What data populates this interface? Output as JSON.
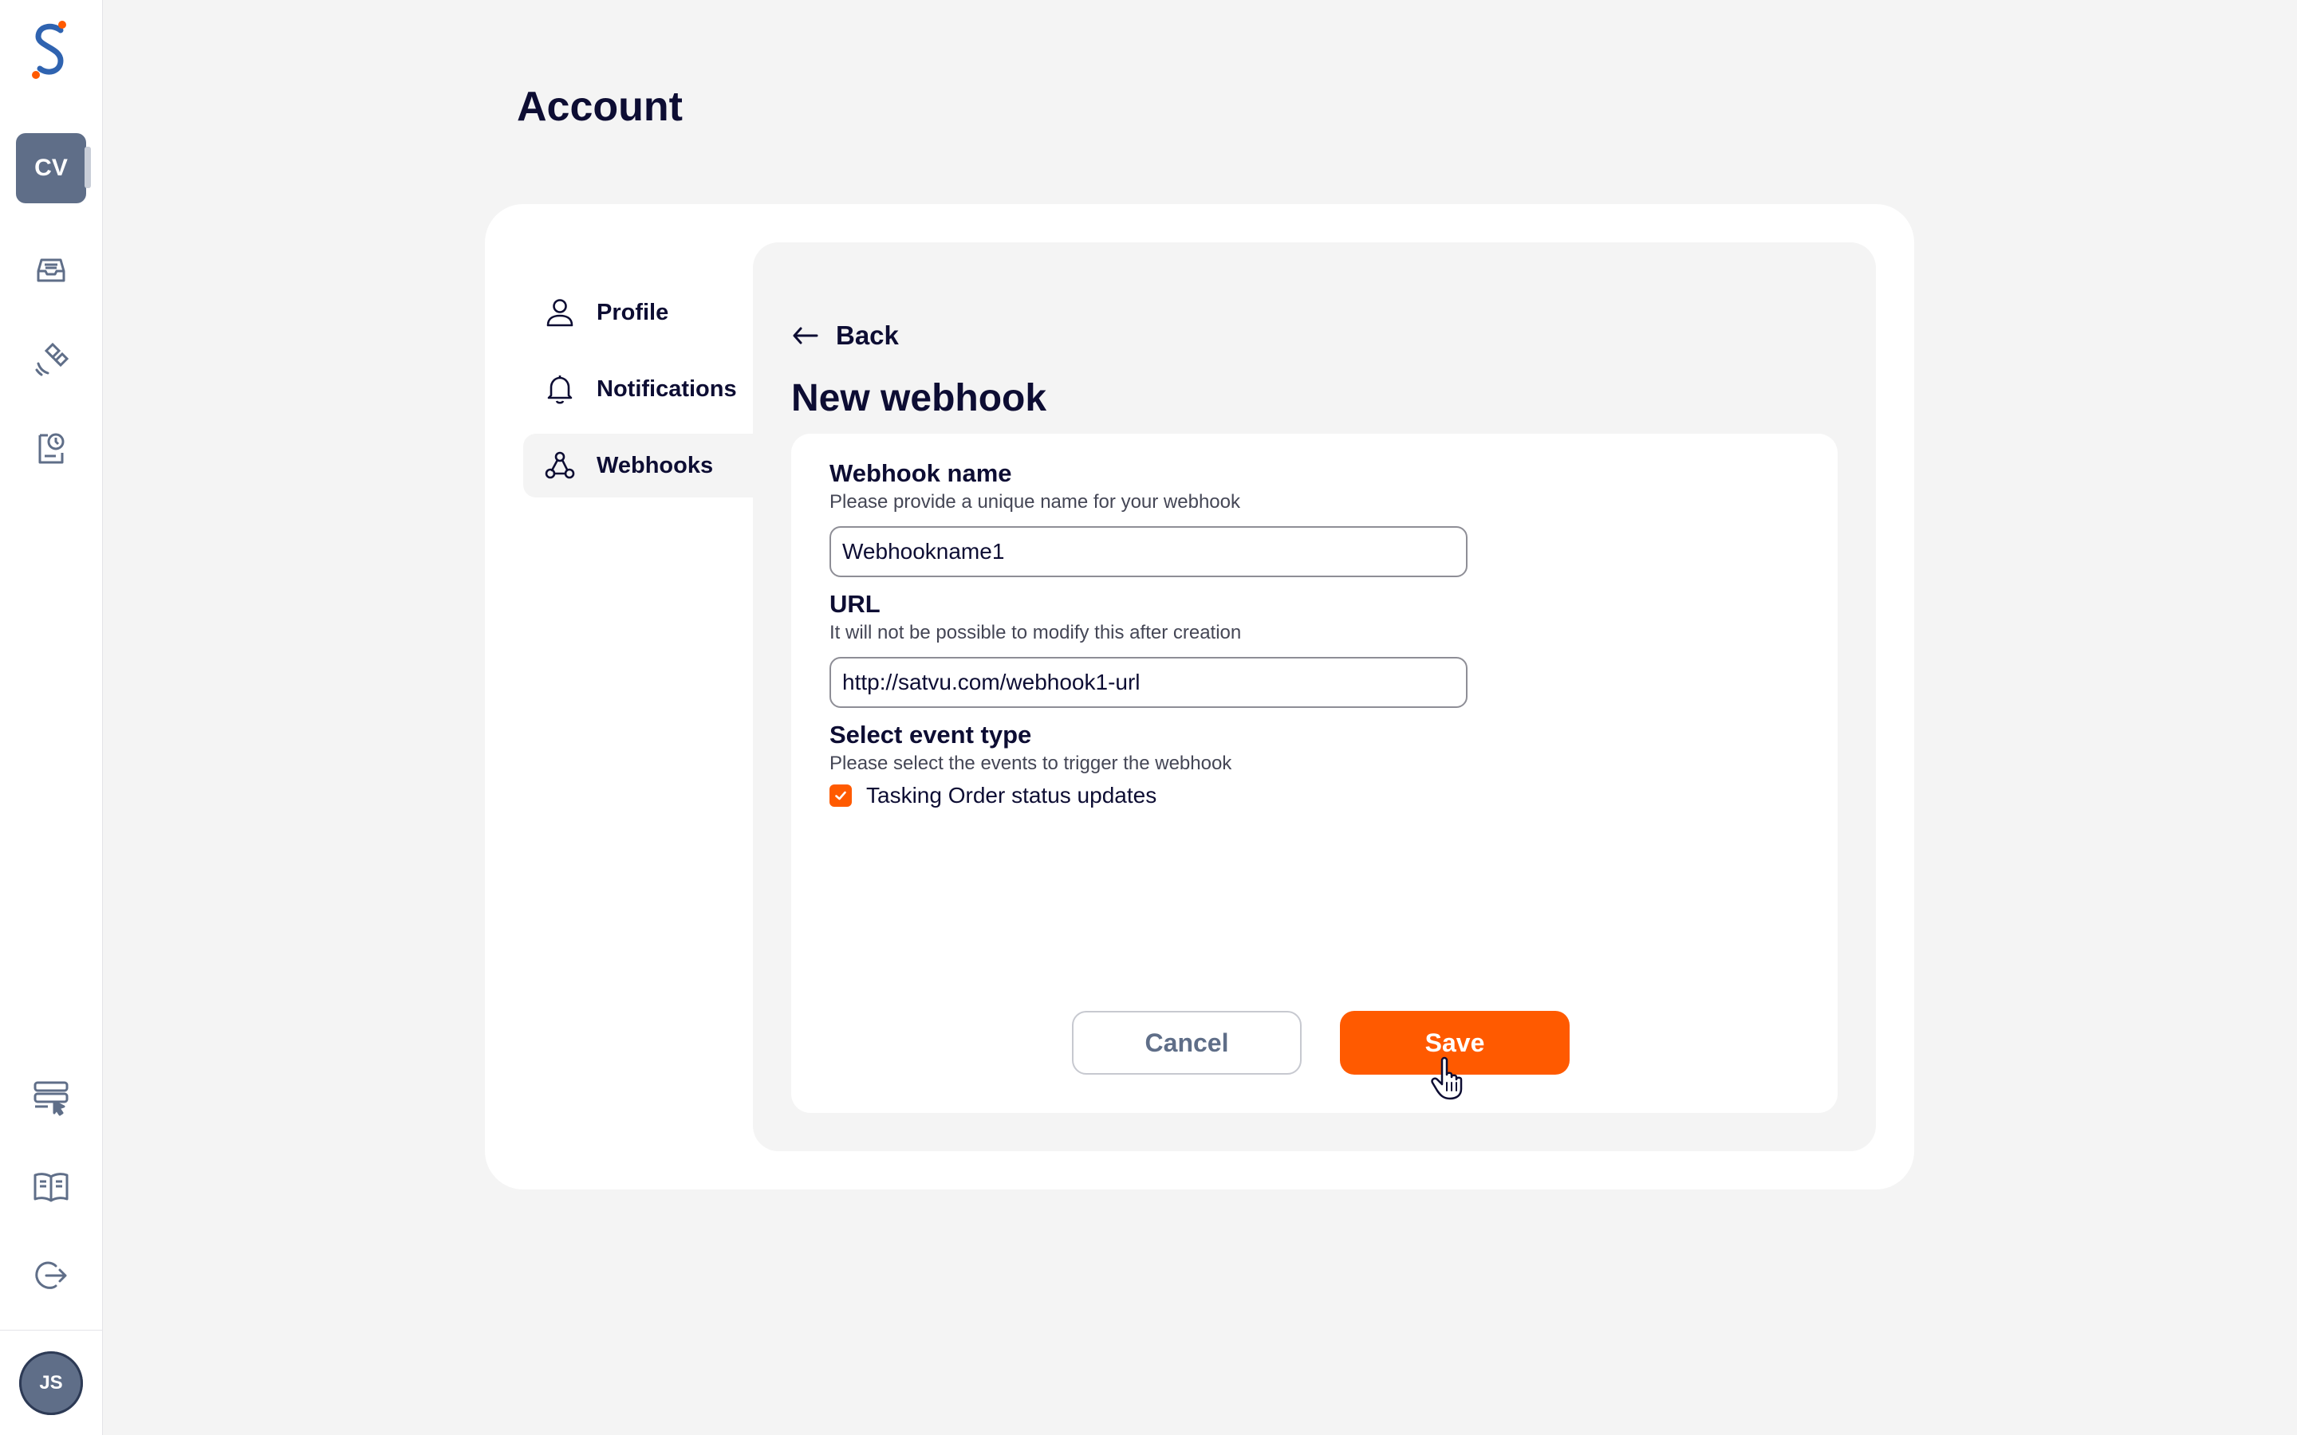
{
  "rail": {
    "org_initials": "CV",
    "user_initials": "JS",
    "nav_icons": [
      "inbox-icon",
      "satellite-icon",
      "orders-icon"
    ],
    "bottom_icons": [
      "api-icon",
      "docs-book-icon",
      "logout-icon"
    ]
  },
  "page": {
    "title": "Account"
  },
  "menu": {
    "items": [
      {
        "label": "Profile",
        "icon": "user-icon"
      },
      {
        "label": "Notifications",
        "icon": "bell-icon"
      },
      {
        "label": "Webhooks",
        "icon": "webhook-icon",
        "active": true
      }
    ]
  },
  "panel": {
    "back_label": "Back",
    "title": "New webhook"
  },
  "form": {
    "name_label": "Webhook name",
    "name_help": "Please provide a unique name for your webhook",
    "name_value": "Webhookname1",
    "url_label": "URL",
    "url_help": "It will not be possible to modify this after creation",
    "url_value": "http://satvu.com/webhook1-url",
    "event_label": "Select event type",
    "event_help": "Please select the events to trigger the webhook",
    "event_option": "Tasking Order status updates",
    "event_checked": true,
    "cancel_label": "Cancel",
    "save_label": "Save"
  },
  "colors": {
    "accent": "#ff5a00",
    "brand_blue": "#2f63b0",
    "rail_avatar": "#5f6e88",
    "text": "#0d0d33"
  }
}
